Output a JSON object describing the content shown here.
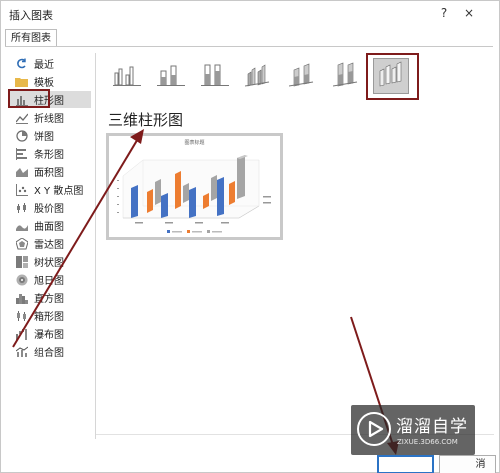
{
  "dialog": {
    "title": "插入图表",
    "help_glyph": "?",
    "close_glyph": "×",
    "tab_label": "所有图表"
  },
  "sidebar": {
    "items": [
      {
        "label": "最近",
        "icon": "recent-icon"
      },
      {
        "label": "模板",
        "icon": "folder-icon"
      },
      {
        "label": "柱形图",
        "icon": "column-chart-icon",
        "selected": true
      },
      {
        "label": "折线图",
        "icon": "line-chart-icon"
      },
      {
        "label": "饼图",
        "icon": "pie-chart-icon"
      },
      {
        "label": "条形图",
        "icon": "bar-chart-icon"
      },
      {
        "label": "面积图",
        "icon": "area-chart-icon"
      },
      {
        "label": "X Y 散点图",
        "icon": "scatter-chart-icon"
      },
      {
        "label": "股价图",
        "icon": "stock-chart-icon"
      },
      {
        "label": "曲面图",
        "icon": "surface-chart-icon"
      },
      {
        "label": "雷达图",
        "icon": "radar-chart-icon"
      },
      {
        "label": "树状图",
        "icon": "treemap-chart-icon"
      },
      {
        "label": "旭日图",
        "icon": "sunburst-chart-icon"
      },
      {
        "label": "直方图",
        "icon": "histogram-chart-icon"
      },
      {
        "label": "箱形图",
        "icon": "box-whisker-chart-icon"
      },
      {
        "label": "瀑布图",
        "icon": "waterfall-chart-icon"
      },
      {
        "label": "组合图",
        "icon": "combo-chart-icon"
      }
    ]
  },
  "subtypes": [
    {
      "icon": "clustered-column-icon"
    },
    {
      "icon": "stacked-column-icon"
    },
    {
      "icon": "100-stacked-column-icon"
    },
    {
      "icon": "3d-clustered-column-icon"
    },
    {
      "icon": "3d-stacked-column-icon"
    },
    {
      "icon": "3d-100-stacked-column-icon"
    },
    {
      "icon": "3d-column-icon",
      "selected": true
    }
  ],
  "main": {
    "subtype_title": "三维柱形图"
  },
  "preview": {
    "title": "图表标题"
  },
  "footer": {
    "cancel_label": "消"
  },
  "watermark": {
    "name": "溜溜自学",
    "url": "ZIXUE.3D66.COM"
  },
  "colors": {
    "series_blue": "#4472c4",
    "series_orange": "#ed7d31",
    "series_gray": "#a5a5a5",
    "annotation": "#7e1b1b",
    "selection_bg": "#dcdcdc",
    "ok_border": "#2b73c5"
  }
}
